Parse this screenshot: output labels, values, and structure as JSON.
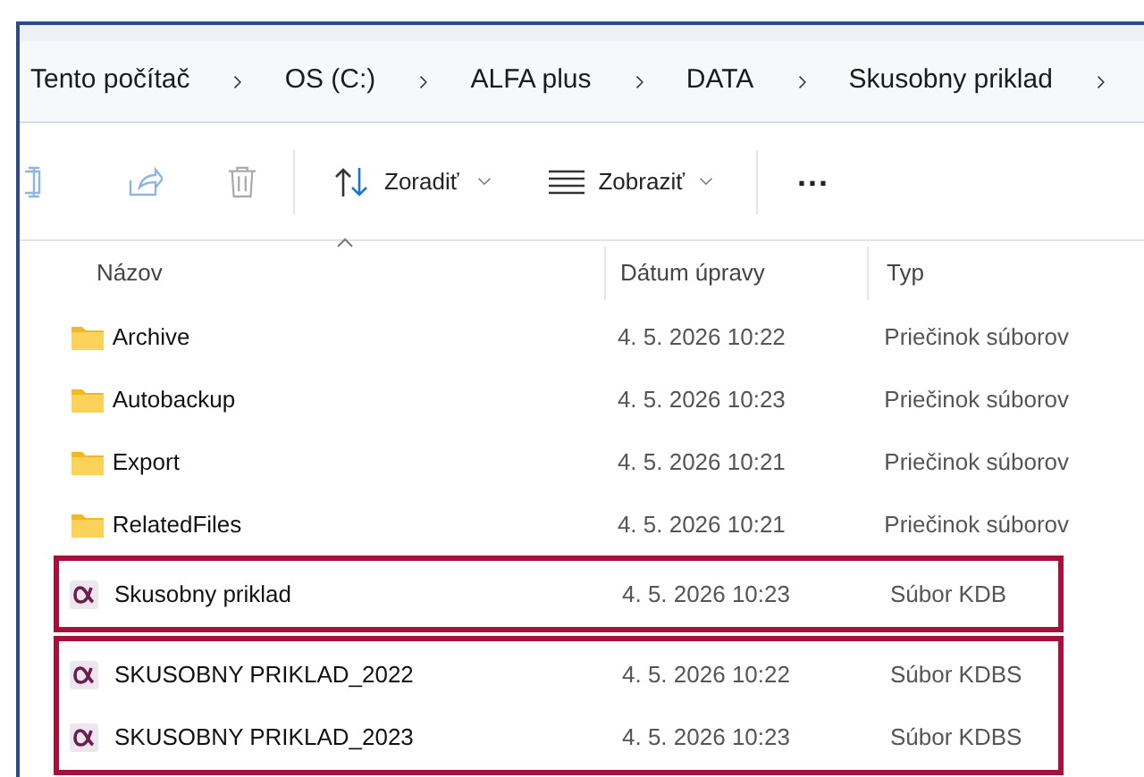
{
  "breadcrumb": [
    "Tento počítač",
    "OS (C:)",
    "ALFA plus",
    "DATA",
    "Skusobny priklad"
  ],
  "toolbar": {
    "sort_label": "Zoradiť",
    "view_label": "Zobraziť",
    "more": "..."
  },
  "columns": [
    "Názov",
    "Dátum úpravy",
    "Typ"
  ],
  "groups": [
    {
      "highlighted": false,
      "rows": [
        {
          "kind": "folder",
          "name": "Archive",
          "date": "4. 5. 2026 10:22",
          "type": "Priečinok súborov"
        },
        {
          "kind": "folder",
          "name": "Autobackup",
          "date": "4. 5. 2026 10:23",
          "type": "Priečinok súborov"
        },
        {
          "kind": "folder",
          "name": "Export",
          "date": "4. 5. 2026 10:21",
          "type": "Priečinok súborov"
        },
        {
          "kind": "folder",
          "name": "RelatedFiles",
          "date": "4. 5. 2026 10:21",
          "type": "Priečinok súborov"
        }
      ]
    },
    {
      "highlighted": true,
      "rows": [
        {
          "kind": "alfa",
          "name": "Skusobny priklad",
          "date": "4. 5. 2026 10:23",
          "type": "Súbor KDB"
        }
      ]
    },
    {
      "highlighted": true,
      "rows": [
        {
          "kind": "alfa",
          "name": "SKUSOBNY PRIKLAD_2022",
          "date": "4. 5. 2026 10:22",
          "type": "Súbor KDBS"
        },
        {
          "kind": "alfa",
          "name": "SKUSOBNY PRIKLAD_2023",
          "date": "4. 5. 2026 10:23",
          "type": "Súbor KDBS"
        }
      ]
    }
  ]
}
